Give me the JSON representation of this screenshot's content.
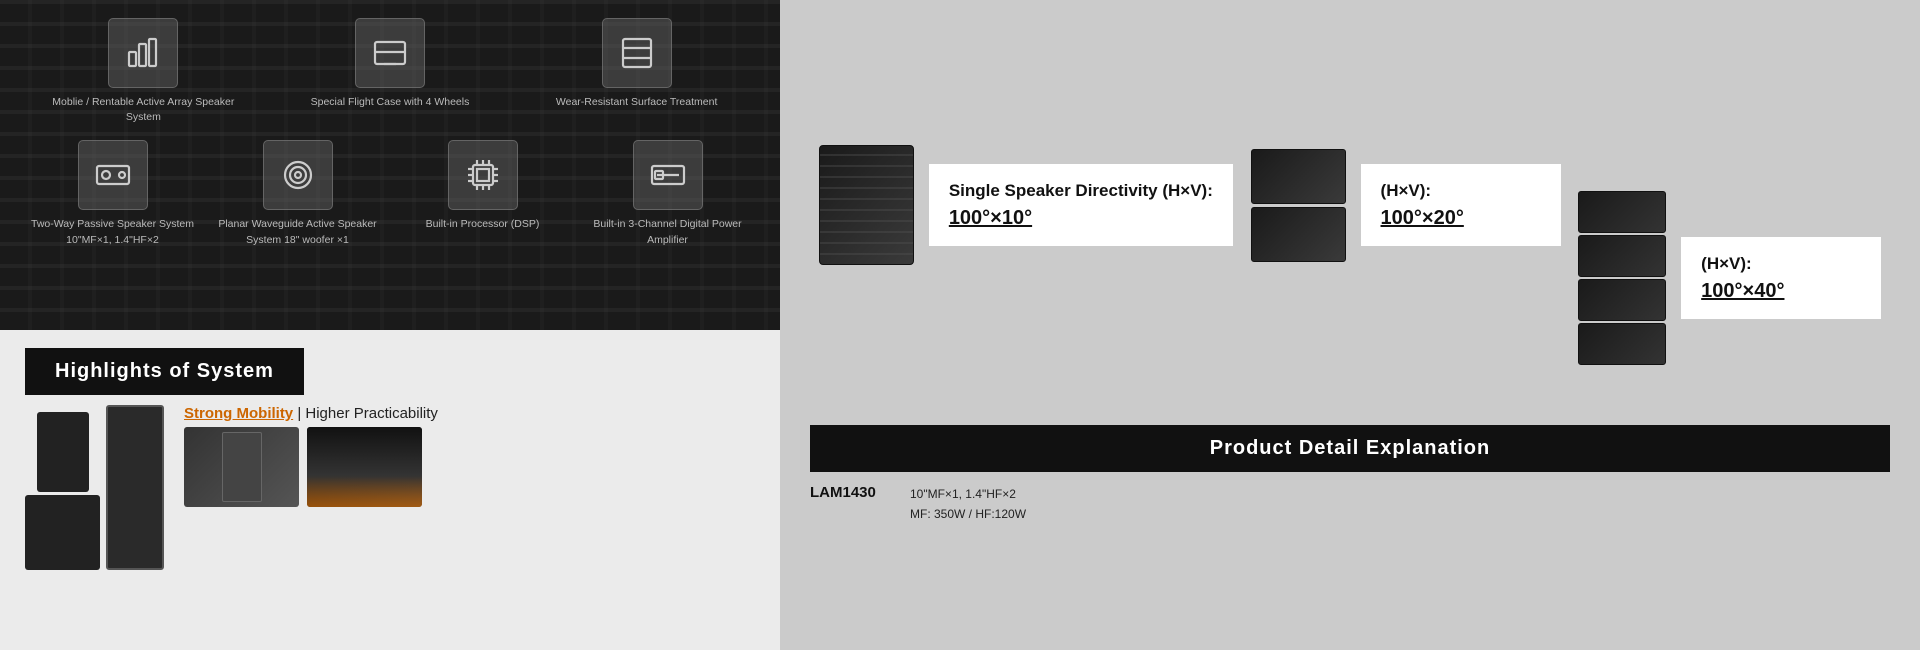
{
  "left_dark": {
    "row1": [
      {
        "id": "mobile-rentable",
        "icon": "bars-chart",
        "label": "Moblie / Rentable\nActive Array\nSpeaker System"
      },
      {
        "id": "special-flight-case",
        "icon": "monitor-case",
        "label": "Special\nFlight Case\nwith 4 Wheels"
      },
      {
        "id": "wear-resistant",
        "icon": "square-surface",
        "label": "Wear-Resistant\nSurface\nTreatment"
      }
    ],
    "row2": [
      {
        "id": "two-way-passive",
        "icon": "speaker-circle",
        "label": "Two-Way Passive\nSpeaker System\n10\"MF×1, 1.4\"HF×2"
      },
      {
        "id": "planar-waveguide",
        "icon": "speaker-ring",
        "label": "Planar Waveguide Active\nSpeaker System\n18\" woofer ×1"
      },
      {
        "id": "builtin-dsp",
        "icon": "processor-chip",
        "label": "Built-in\nProcessor (DSP)"
      },
      {
        "id": "builtin-amplifier",
        "icon": "amplifier-bar",
        "label": "Built-in\n3-Channel Digital\nPower Amplifier"
      }
    ]
  },
  "highlights": {
    "title": "Highlights of System",
    "mobility_label": "Strong Mobility",
    "mobility_rest": " | Higher Practicability"
  },
  "directivity": {
    "single_speaker": {
      "title": "Single Speaker\nDirectivity (H×V):",
      "value": "100°×10°"
    },
    "double_speaker": {
      "title": "(H×V):",
      "value": "100°×20°"
    },
    "quad_speaker": {
      "title": "(H×V):",
      "value": "100°×40°"
    }
  },
  "product_detail": {
    "title": "Product Detail Explanation",
    "model": "LAM1430",
    "specs_line1": "10\"MF×1, 1.4\"HF×2",
    "specs_line2": "MF: 350W / HF:120W"
  }
}
